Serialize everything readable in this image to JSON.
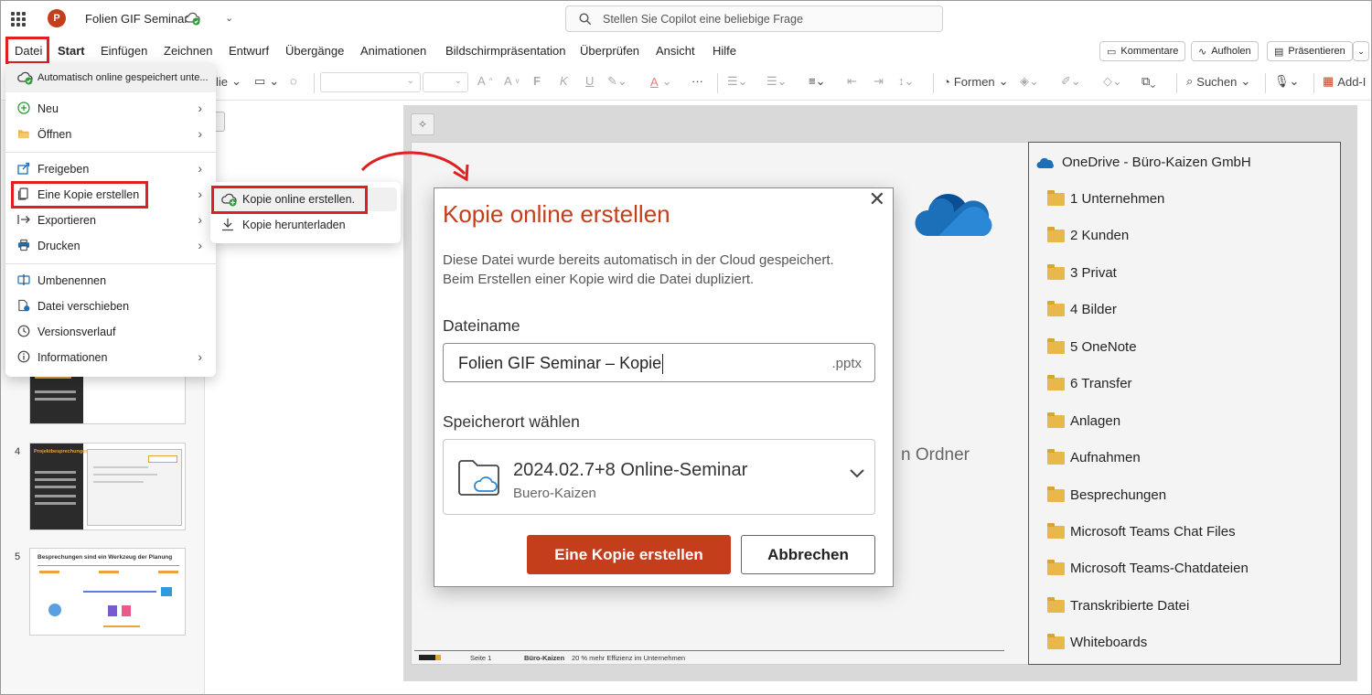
{
  "titlebar": {
    "doc_title": "Folien GIF Seminar",
    "search_placeholder": "Stellen Sie Copilot eine beliebige Frage"
  },
  "tabs": [
    "Datei",
    "Start",
    "Einfügen",
    "Zeichnen",
    "Entwurf",
    "Übergänge",
    "Animationen",
    "Bildschirmpräsentation",
    "Überprüfen",
    "Ansicht",
    "Hilfe"
  ],
  "right_buttons": {
    "comments": "Kommentare",
    "record": "Aufholen",
    "present": "Präsentieren"
  },
  "ribbon": {
    "layout_partial": "lie",
    "shapes": "Formen",
    "search": "Suchen",
    "addins": "Add-I"
  },
  "file_menu": {
    "autosave": "Automatisch online gespeichert unte...",
    "items": [
      "Neu",
      "Öffnen",
      "Freigeben",
      "Eine Kopie erstellen",
      "Exportieren",
      "Drucken",
      "Umbenennen",
      "Datei verschieben",
      "Versionsverlauf",
      "Informationen"
    ]
  },
  "submenu": {
    "online": "Kopie online erstellen.",
    "download": "Kopie herunterladen"
  },
  "thumbnails": {
    "num4": "4",
    "num5": "5",
    "slide4_title": "Projektbesprechungen",
    "slide5_title": "Besprechungen sind ein Werkzeug der Planung"
  },
  "slide": {
    "ordner": "n Ordner",
    "footer_page": "Seite 1",
    "footer_brand": "Büro-Kaizen",
    "footer_slogan": "20 % mehr Effizienz im Unternehmen"
  },
  "onedrive": {
    "header": "OneDrive - Büro-Kaizen GmbH",
    "folders": [
      "1 Unternehmen",
      "2 Kunden",
      "3 Privat",
      "4 Bilder",
      "5 OneNote",
      "6 Transfer",
      "Anlagen",
      "Aufnahmen",
      "Besprechungen",
      "Microsoft Teams Chat Files",
      "Microsoft Teams-Chatdateien",
      "Transkribierte Datei",
      "Whiteboards"
    ]
  },
  "dialog": {
    "title": "Kopie online erstellen",
    "desc_line1": "Diese Datei wurde bereits automatisch in der Cloud gespeichert.",
    "desc_line2": "Beim Erstellen einer Kopie wird die Datei dupliziert.",
    "filename_label": "Dateiname",
    "filename_value": "Folien GIF Seminar – Kopie",
    "extension": ".pptx",
    "location_label": "Speicherort wählen",
    "location_main": "2024.02.7+8 Online-Seminar",
    "location_sub": "Buero-Kaizen",
    "primary_button": "Eine Kopie erstellen",
    "secondary_button": "Abbrechen"
  },
  "colors": {
    "accent": "#c43e1c",
    "highlight_box": "#e02020",
    "folder": "#e8b94a"
  }
}
